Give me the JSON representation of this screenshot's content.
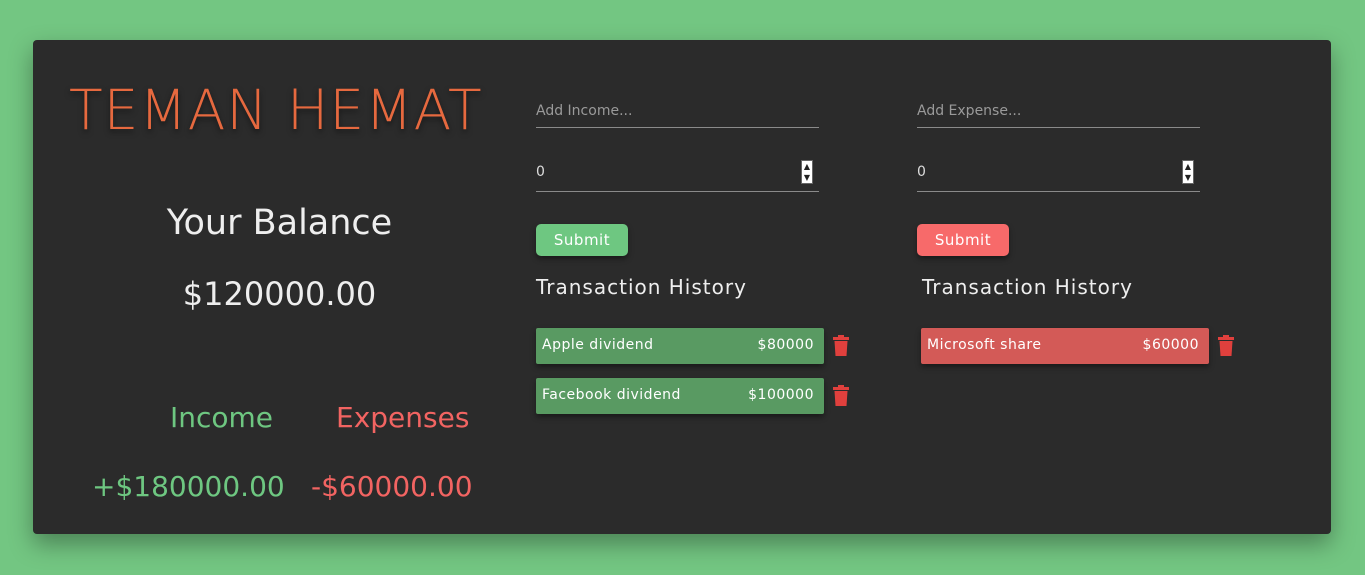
{
  "app": {
    "title": "TEMAN HEMAT"
  },
  "balance": {
    "label": "Your Balance",
    "value": "$120000.00"
  },
  "summary": {
    "income_label": "Income",
    "expense_label": "Expenses",
    "income_value": "+$180000.00",
    "expense_value": "-$60000.00"
  },
  "income_form": {
    "text_placeholder": "Add Income...",
    "text_value": "",
    "amount_value": "0",
    "submit_label": "Submit"
  },
  "expense_form": {
    "text_placeholder": "Add Expense...",
    "text_value": "",
    "amount_value": "0",
    "submit_label": "Submit"
  },
  "income_history": {
    "title": "Transaction History",
    "items": [
      {
        "name": "Apple dividend",
        "amount": "$80000"
      },
      {
        "name": "Facebook dividend",
        "amount": "$100000"
      }
    ]
  },
  "expense_history": {
    "title": "Transaction History",
    "items": [
      {
        "name": "Microsoft share",
        "amount": "$60000"
      }
    ]
  },
  "icons": {
    "delete": "trash-icon",
    "spinner_up": "chevron-up-icon",
    "spinner_down": "chevron-down-icon"
  },
  "colors": {
    "background": "#73c682",
    "card": "#2b2b2b",
    "title": "#e6693f",
    "income": "#6ec781",
    "expense": "#f26462",
    "income_item": "#599a62",
    "expense_item": "#d35a57",
    "trash": "#e0403d"
  }
}
